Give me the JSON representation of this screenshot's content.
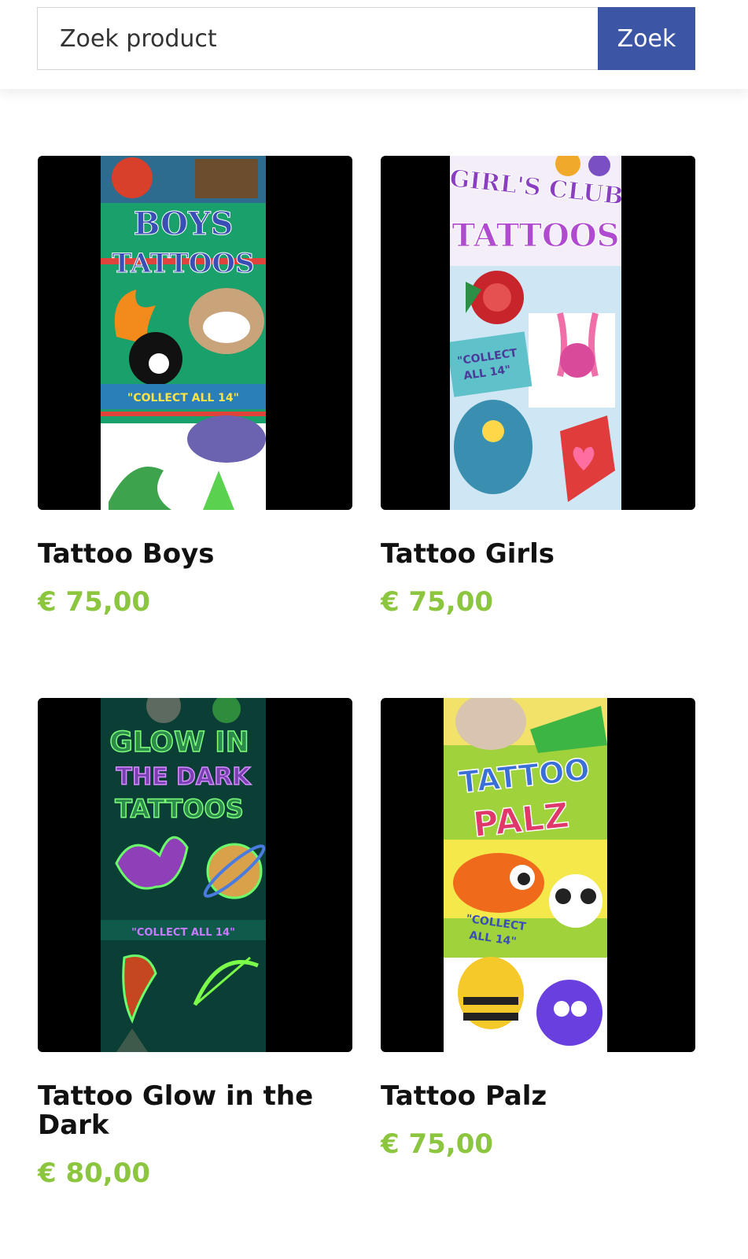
{
  "search": {
    "placeholder": "Zoek product",
    "button_label": "Zoek"
  },
  "products": [
    {
      "title": "Tattoo Boys",
      "price": "€ 75,00",
      "image_text": [
        "BOYS",
        "TATTOOS",
        "\"COLLECT ALL 14\""
      ]
    },
    {
      "title": "Tattoo Girls",
      "price": "€ 75,00",
      "image_text": [
        "GIRL'S CLUB",
        "TATTOOS",
        "\"COLLECT",
        "ALL 14\""
      ]
    },
    {
      "title": "Tattoo Glow in the Dark",
      "price": "€ 80,00",
      "image_text": [
        "GLOW IN",
        "THE DARK",
        "TATTOOS",
        "\"COLLECT ALL 14\""
      ]
    },
    {
      "title": "Tattoo Palz",
      "price": "€ 75,00",
      "image_text": [
        "TATTOO",
        "PALZ",
        "\"COLLECT",
        "ALL 14\""
      ]
    }
  ],
  "colors": {
    "accent_blue": "#3c55a5",
    "price_green": "#8cc63f"
  }
}
